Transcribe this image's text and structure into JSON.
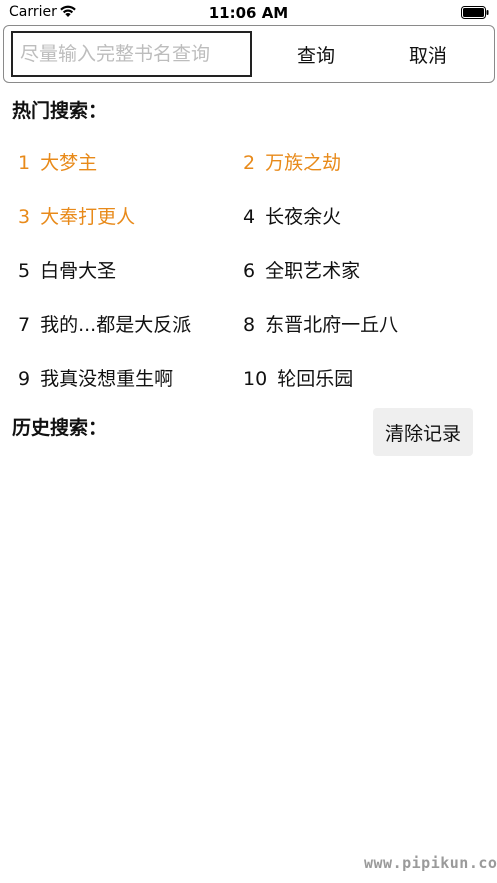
{
  "status_bar": {
    "carrier": "Carrier",
    "time": "11:06 AM",
    "wifi_icon": "wifi-icon",
    "battery_icon": "battery-icon"
  },
  "search": {
    "placeholder": "尽量输入完整书名查询",
    "value": "",
    "query_label": "查询",
    "cancel_label": "取消"
  },
  "hot": {
    "title": "热门搜索：",
    "items": [
      {
        "rank": "1",
        "name": "大梦主",
        "highlight": true
      },
      {
        "rank": "2",
        "name": "万族之劫",
        "highlight": true
      },
      {
        "rank": "3",
        "name": "大奉打更人",
        "highlight": true
      },
      {
        "rank": "4",
        "name": "长夜余火",
        "highlight": false
      },
      {
        "rank": "5",
        "name": "白骨大圣",
        "highlight": false
      },
      {
        "rank": "6",
        "name": "全职艺术家",
        "highlight": false
      },
      {
        "rank": "7",
        "name": "我的...都是大反派",
        "highlight": false
      },
      {
        "rank": "8",
        "name": "东晋北府一丘八",
        "highlight": false
      },
      {
        "rank": "9",
        "name": "我真没想重生啊",
        "highlight": false
      },
      {
        "rank": "10",
        "name": "轮回乐园",
        "highlight": false
      }
    ]
  },
  "history": {
    "title": "历史搜索：",
    "clear_label": "清除记录"
  },
  "colors": {
    "highlight": "#e88a1a",
    "text": "#111111",
    "clear_bg": "#efefef"
  },
  "watermark": "www.pipikun.com"
}
